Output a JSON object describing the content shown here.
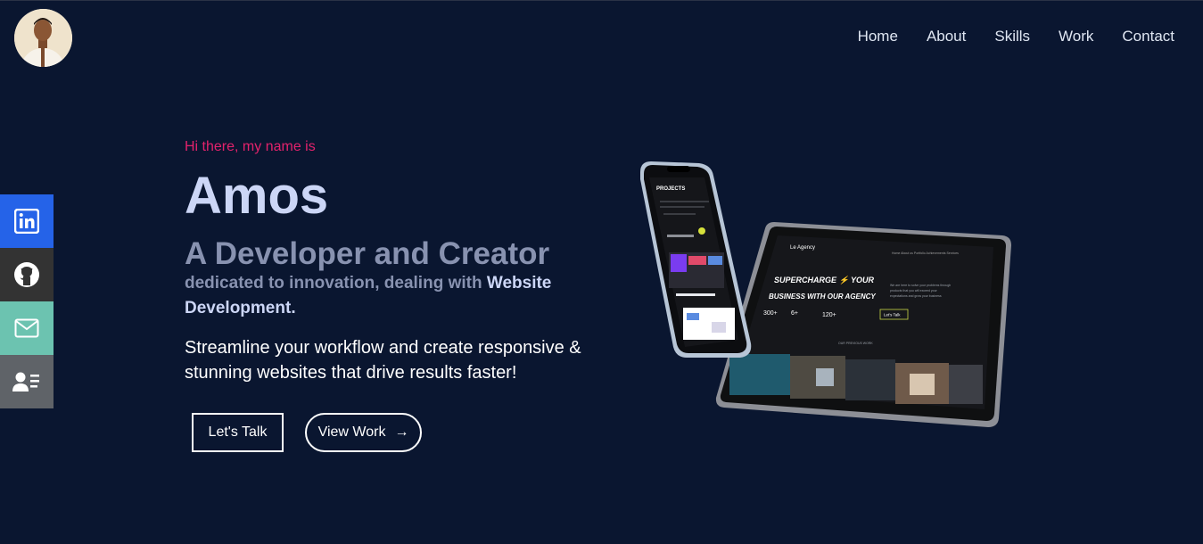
{
  "header": {
    "nav": [
      "Home",
      "About",
      "Skills",
      "Work",
      "Contact"
    ]
  },
  "social": [
    "linkedin-icon",
    "github-icon",
    "mail-icon",
    "resume-icon"
  ],
  "hero": {
    "greeting": "Hi there, my name is",
    "name": "Amos",
    "role": "A Developer and Creator",
    "dedicated_prefix": "dedicated to innovation, dealing with",
    "dedicated_highlight": "Website Development",
    "dedicated_suffix": ".",
    "pitch": "Streamline your workflow and create responsive & stunning websites that drive results faster!",
    "cta_talk": "Let's Talk",
    "cta_work": "View Work",
    "cta_work_arrow": "→"
  },
  "mockup": {
    "phone_title": "PROJECTS",
    "tablet_brand": "Le Agency",
    "tablet_headline_1": "SUPERCHARGE ⚡ YOUR",
    "tablet_headline_2": "BUSINESS WITH OUR AGENCY",
    "stat_1": "300+",
    "stat_2": "6+",
    "stat_3": "120+",
    "tablet_cta": "Let's Talk"
  },
  "colors": {
    "background": "#0a1630",
    "accent": "#e3226c",
    "heading": "#ccd6f6",
    "muted": "#8892b0"
  }
}
